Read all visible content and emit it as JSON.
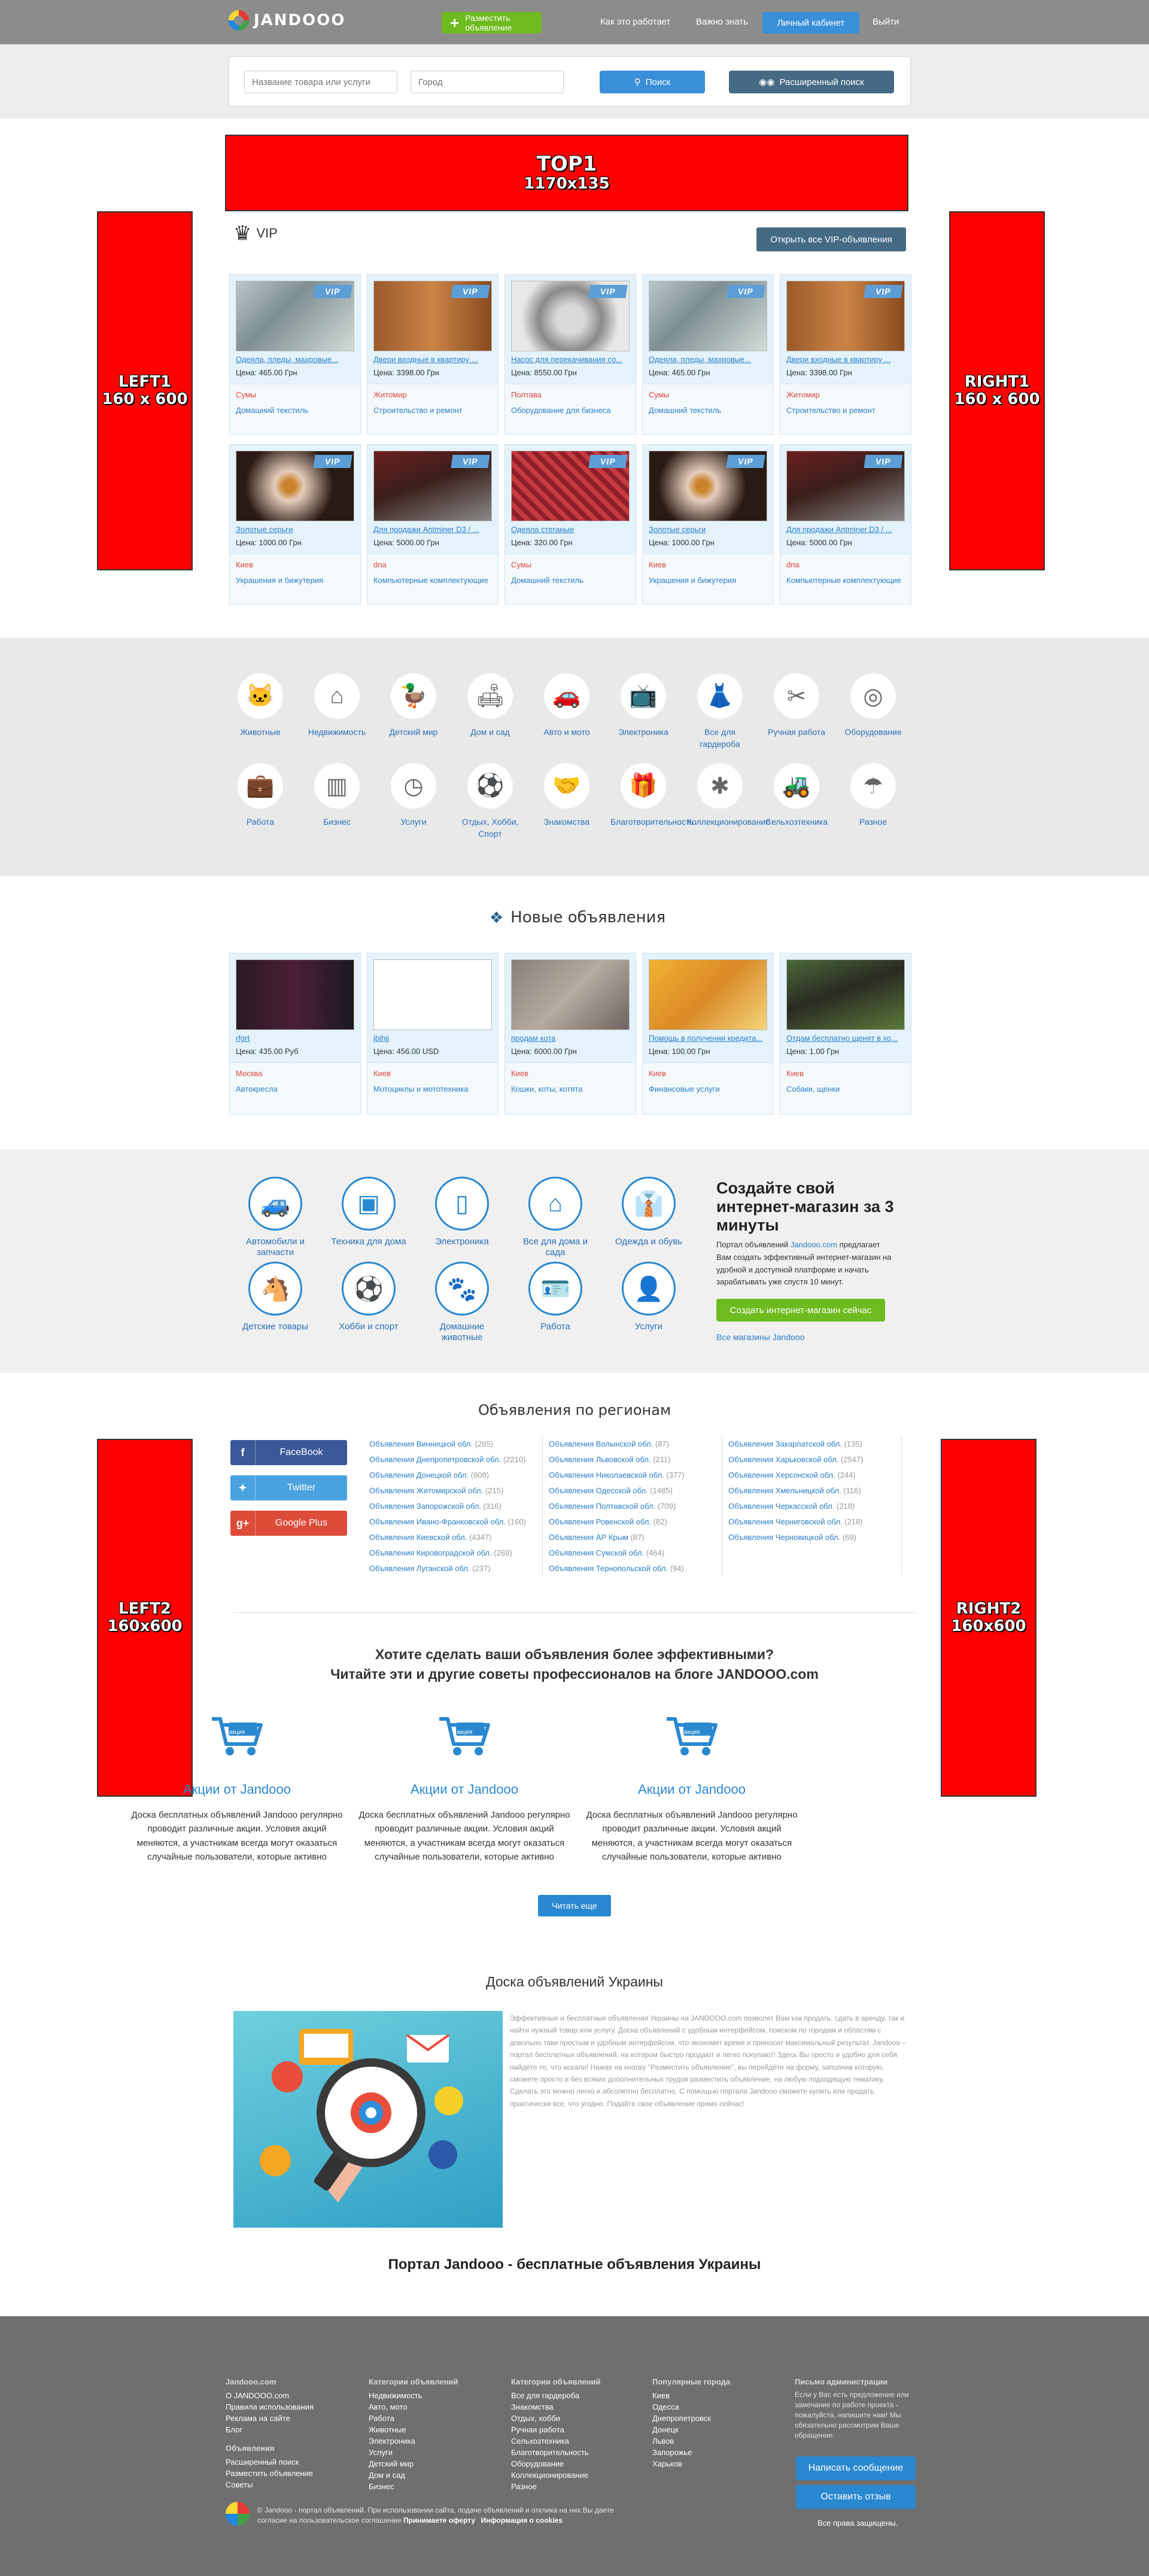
{
  "header": {
    "logo": "JANDOOO",
    "post_label": "Разместить объявление",
    "nav": [
      "Как это работает",
      "Важно знать"
    ],
    "cabinet_label": "Личный кабинет",
    "logout_label": "Выйти"
  },
  "search": {
    "query_placeholder": "Название товара или услуги",
    "city_placeholder": "Город",
    "search_label": "Поиск",
    "advanced_label": "Расширенный поиск"
  },
  "banners": {
    "top": [
      "TOP1",
      "1170x135"
    ],
    "left1": [
      "LEFT1",
      "160 x 600"
    ],
    "right1": [
      "RIGHT1",
      "160 x 600"
    ],
    "left2": [
      "LEFT2",
      "160x600"
    ],
    "right2": [
      "RIGHT2",
      "160x600"
    ]
  },
  "vip": {
    "title": "VIP",
    "open_all": "Открыть все VIP-объявления",
    "tag": "VIP",
    "cards": [
      {
        "title": "Одеяла, пледы, махровые...",
        "price": "Цена: 465.00 Грн",
        "city": "Сумы",
        "category": "Домашний текстиль"
      },
      {
        "title": "Двери входные в квартиру ...",
        "price": "Цена: 3398.00 Грн",
        "city": "Житомир",
        "category": "Строительство и ремонт"
      },
      {
        "title": "Насос для перекачивания со...",
        "price": "Цена: 8550.00 Грн",
        "city": "Полтава",
        "category": "Оборудование для бизнеса"
      },
      {
        "title": "Одеяла, пледы, махровые...",
        "price": "Цена: 465.00 Грн",
        "city": "Сумы",
        "category": "Домашний текстиль"
      },
      {
        "title": "Двери входные в квартиру ...",
        "price": "Цена: 3398.00 Грн",
        "city": "Житомир",
        "category": "Строительство и ремонт"
      },
      {
        "title": "Золотые серьги",
        "price": "Цена: 1000.00 Грн",
        "city": "Киев",
        "category": "Украшения и бижутерия"
      },
      {
        "title": "Для продажи Antminer D3 / ...",
        "price": "Цена: 5000.00 Грн",
        "city": "dna",
        "category": "Компьютерные комплектующие"
      },
      {
        "title": "Одеяла стеганые",
        "price": "Цена: 320.00 Грн",
        "city": "Сумы",
        "category": "Домашний текстиль"
      },
      {
        "title": "Золотые серьги",
        "price": "Цена: 1000.00 Грн",
        "city": "Киев",
        "category": "Украшения и бижутерия"
      },
      {
        "title": "Для продажи Antminer D3 / ...",
        "price": "Цена: 5000.00 Грн",
        "city": "dna",
        "category": "Компьютерные комплектующие"
      }
    ]
  },
  "categories": [
    {
      "label": "Животные",
      "icon": "cat-icon"
    },
    {
      "label": "Недвижимость",
      "icon": "house-icon"
    },
    {
      "label": "Детский мир",
      "icon": "duck-icon"
    },
    {
      "label": "Дом и сад",
      "icon": "sofa-icon"
    },
    {
      "label": "Авто и мото",
      "icon": "car-icon"
    },
    {
      "label": "Электроника",
      "icon": "tv-icon"
    },
    {
      "label": "Все для гардероба",
      "icon": "dress-icon"
    },
    {
      "label": "Ручная работа",
      "icon": "scissors-icon"
    },
    {
      "label": "Оборудование",
      "icon": "washer-icon"
    },
    {
      "label": "Работа",
      "icon": "briefcase-icon"
    },
    {
      "label": "Бизнес",
      "icon": "binders-icon"
    },
    {
      "label": "Услуги",
      "icon": "clock-icon"
    },
    {
      "label": "Отдых, Хобби, Спорт",
      "icon": "sport-icon"
    },
    {
      "label": "Знакомства",
      "icon": "handshake-icon"
    },
    {
      "label": "Благотворительность",
      "icon": "gift-icon"
    },
    {
      "label": "Коллекционирование",
      "icon": "stamp-icon"
    },
    {
      "label": "Сельхозтехника",
      "icon": "tractor-icon"
    },
    {
      "label": "Разное",
      "icon": "umbrella-icon"
    }
  ],
  "new_ads": {
    "title": "Новые объявления",
    "cards": [
      {
        "title": "rfgrt",
        "price": "Цена: 435.00 Руб",
        "city": "Москва",
        "category": "Автокресла"
      },
      {
        "title": "jbjhjj",
        "price": "Цена: 456.00 USD",
        "city": "Киев",
        "category": "Мотоциклы и мототехника"
      },
      {
        "title": "продам кота",
        "price": "Цена: 6000.00 Грн",
        "city": "Киев",
        "category": "Кошки, коты, котята"
      },
      {
        "title": "Помощь в получении кредита...",
        "price": "Цена: 100.00 Грн",
        "city": "Киев",
        "category": "Финансовые услуги"
      },
      {
        "title": "Отдам бесплатно щенят в хо...",
        "price": "Цена: 1.00 Грн",
        "city": "Киев",
        "category": "Собаки, щенки"
      }
    ]
  },
  "shop": {
    "items": [
      "Автомобили и запчасти",
      "Техника для дома",
      "Электроника",
      "Все для дома и сада",
      "Одежда и обувь",
      "Детские товары",
      "Хобби и спорт",
      "Домашние животные",
      "Работа",
      "Услуги"
    ],
    "title": "Создайте свой интернет-магазин за 3 минуты",
    "text_pre": "Портал объявлений ",
    "text_link": "Jandooo.com",
    "text_post": " предлагает Вам создать эффективный интернет-магазин на удобной и доступной платформе и начать зарабатывать уже спустя 10 минут.",
    "button": "Создать интернет-магазин сейчас",
    "all_link": "Все магазины Jandooo"
  },
  "regions": {
    "title": "Объявления по регионам",
    "social": [
      "FaceBook",
      "Twitter",
      "Google Plus"
    ],
    "col1": [
      [
        "Объявления Винницкой обл.",
        "(265)"
      ],
      [
        "Объявления Днепропетровской обл.",
        "(2210)"
      ],
      [
        "Объявления Донецкой обл.",
        "(908)"
      ],
      [
        "Объявления Житомирской обл.",
        "(215)"
      ],
      [
        "Объявления Запорожской обл.",
        "(316)"
      ],
      [
        "Объявления Ивано-Франковской обл.",
        "(160)"
      ],
      [
        "Объявления Киевской обл.",
        "(4347)"
      ],
      [
        "Объявления Кировоградской обл.",
        "(269)"
      ],
      [
        "Объявления Луганской обл.",
        "(237)"
      ]
    ],
    "col2": [
      [
        "Объявления Волынской обл.",
        "(87)"
      ],
      [
        "Объявления Львовской обл.",
        "(211)"
      ],
      [
        "Объявления Николаевской обл.",
        "(377)"
      ],
      [
        "Объявления Одесской обл.",
        "(1485)"
      ],
      [
        "Объявления Полтавской обл.",
        "(709)"
      ],
      [
        "Объявления Ровенской обл.",
        "(82)"
      ],
      [
        "Объявления АР Крым",
        "(87)"
      ],
      [
        "Объявления Сумской обл.",
        "(464)"
      ],
      [
        "Объявления Тернопольской обл.",
        "(94)"
      ]
    ],
    "col3": [
      [
        "Объявления Закарпатской обл.",
        "(135)"
      ],
      [
        "Объявления Харьковской обл.",
        "(2547)"
      ],
      [
        "Объявления Херсонской обл.",
        "(244)"
      ],
      [
        "Объявления Хмельницкой обл.",
        "(116)"
      ],
      [
        "Объявления Черкасской обл.",
        "(218)"
      ],
      [
        "Объявления Черниговской обл.",
        "(218)"
      ],
      [
        "Объявления Черновицкой обл.",
        "(69)"
      ]
    ]
  },
  "blog": {
    "title1": "Хотите сделать ваши объявления более эффективными?",
    "title2": "Читайте эти и другие советы профессионалов на блоге JANDOOO.com",
    "cart_label": "акция",
    "promo_title": "Акции от Jandooo",
    "promo_text": "Доска бесплатных объявлений Jandooo регулярно проводит различные акции. Условия акций меняются, а участникам всегда могут оказаться случайные пользователи, которые активно",
    "read_more": "Читать еще"
  },
  "board": {
    "title": "Доска объявлений Украины",
    "text": "Эффективные и бесплатные объявления Украины на JANDOOO.com позволят Вам как продать, сдать в аренду, так и найти нужный товар или услугу. Доска объявлений с удобным интерфейсом, поиском по городам и областям с довольно таки простым и удобным интерфейсом, что экономит время и приносит максимальный результат. Jandooo – портал бесплатных объявлений, на котором быстро продают и легко покупают! Здесь Вы просто и удобно для себя найдёте то, что искали! Нажав на кнопку \"Разместить объявление\", вы перейдёте на форму, заполнив которую, сможете просто и без всяких дополнительных трудов разместить объявление, на любую подходящую тематику. Сделать это можно легко и абсолютно бесплатно. С помощью портала Jandooo сможете купить или продать практически все, что угодно. Подайте свое объявление прямо сейчас!",
    "portal": "Портал Jandooo - бесплатные объявления Украины"
  },
  "footer": {
    "col1_title": "Jandooo.com",
    "col1": [
      "О JANDOOO.com",
      "Правила использования",
      "Реклама на сайте",
      "Блог"
    ],
    "col1b_title": "Объявления",
    "col1b": [
      "Расширенный поиск",
      "Разместить объявление",
      "Советы"
    ],
    "col2_title": "Категории объявлений",
    "col2": [
      "Недвижимость",
      "Авто, мото",
      "Работа",
      "Животные",
      "Электроника",
      "Услуги",
      "Детский мир",
      "Дом и сад",
      "Бизнес"
    ],
    "col3_title": "Категории объявлений",
    "col3": [
      "Все для гардероба",
      "Знакомства",
      "Отдых, хобби",
      "Ручная работа",
      "Сельхозтехника",
      "Благотворительность",
      "Оборудование",
      "Коллекционирование",
      "Разное"
    ],
    "col4_title": "Популярные города",
    "col4": [
      "Киев",
      "Одесса",
      "Днепропетровск",
      "Донецк",
      "Львов",
      "Запорожье",
      "Харьков"
    ],
    "col5_title": "Письмо администрации",
    "col5_text": "Если у Вас есть предложение или замечание по работе проекта - пожалуйста, напишите нам! Мы обязательно рассмотрим Ваше обращение.",
    "write_btn": "Написать сообщение",
    "review_btn": "Оставить отзыв",
    "rights": "Все права защищены.",
    "copyright": "© Jandooo - портал объявлений. При использовании сайта, подаче объявлений и отклика на них Вы даете согласие на пользовательское соглашение",
    "offer_link": "Принимаете оферту",
    "cookie_link": "Информация о cookies"
  },
  "colors": {
    "accent": "#3a8fd9",
    "green": "#6dbb1e",
    "banner": "#ff0000",
    "header": "#8c8c8c",
    "footer": "#6f6f6f"
  }
}
